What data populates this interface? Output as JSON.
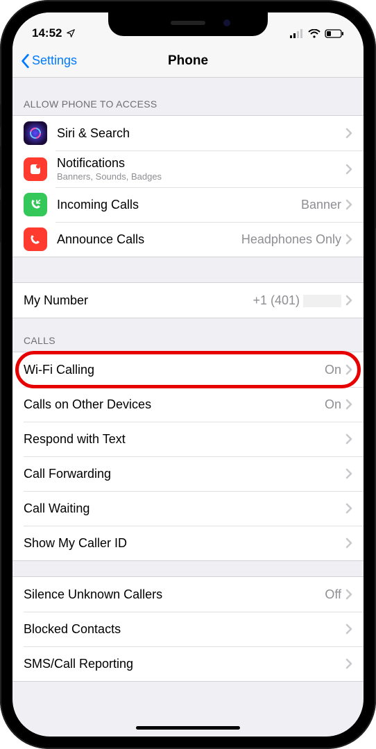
{
  "status": {
    "time": "14:52",
    "location_active": true
  },
  "nav": {
    "back_label": "Settings",
    "title": "Phone"
  },
  "sections": {
    "access_header": "ALLOW PHONE TO ACCESS",
    "access": [
      {
        "label": "Siri & Search",
        "sublabel": ""
      },
      {
        "label": "Notifications",
        "sublabel": "Banners, Sounds, Badges"
      },
      {
        "label": "Incoming Calls",
        "value": "Banner"
      },
      {
        "label": "Announce Calls",
        "value": "Headphones Only"
      }
    ],
    "my_number": {
      "label": "My Number",
      "value_prefix": "+1 (401)"
    },
    "calls_header": "CALLS",
    "calls": [
      {
        "label": "Wi-Fi Calling",
        "value": "On",
        "highlight": true
      },
      {
        "label": "Calls on Other Devices",
        "value": "On"
      },
      {
        "label": "Respond with Text"
      },
      {
        "label": "Call Forwarding"
      },
      {
        "label": "Call Waiting"
      },
      {
        "label": "Show My Caller ID"
      }
    ],
    "misc": [
      {
        "label": "Silence Unknown Callers",
        "value": "Off"
      },
      {
        "label": "Blocked Contacts"
      },
      {
        "label": "SMS/Call Reporting"
      }
    ]
  }
}
